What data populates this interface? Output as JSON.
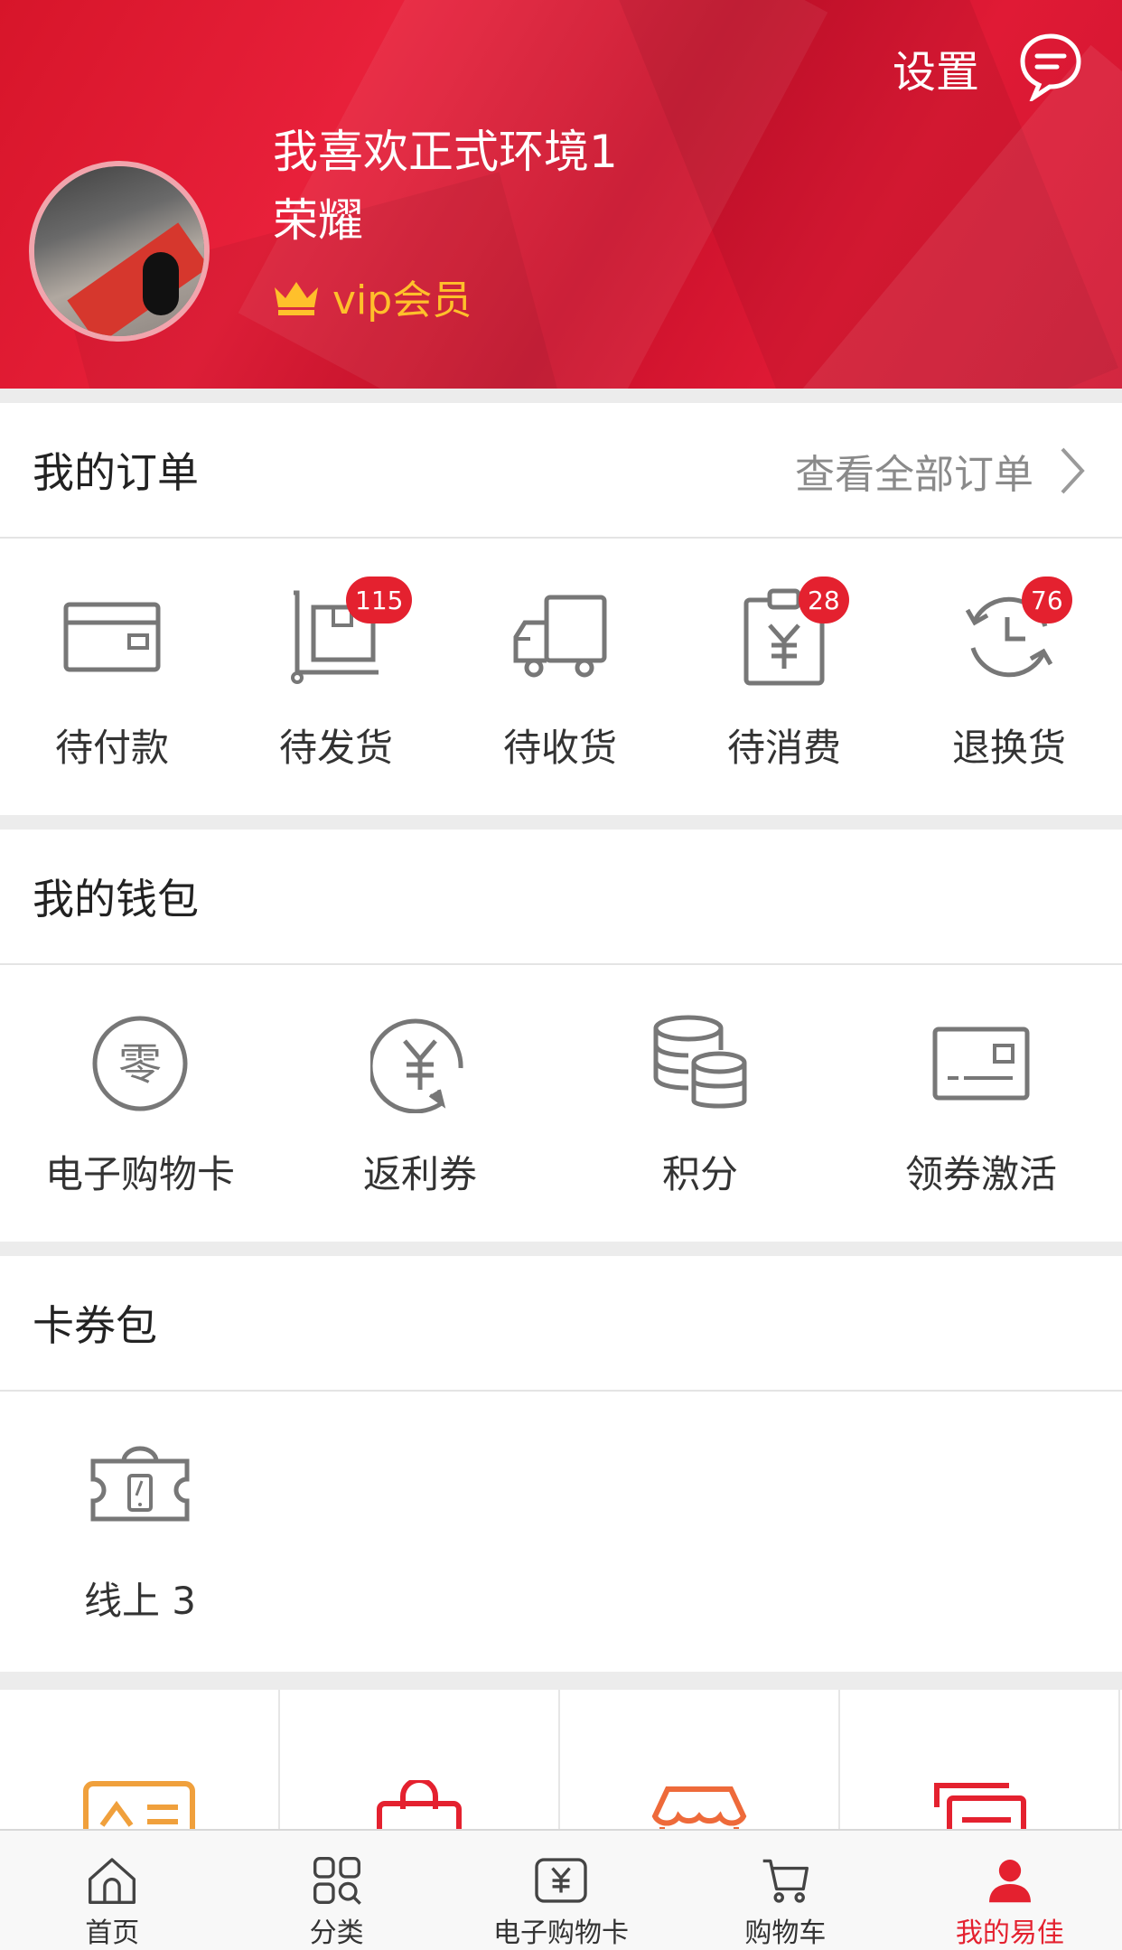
{
  "header": {
    "settings_label": "设置",
    "username": "我喜欢正式环境1荣耀",
    "vip_label": "vip会员"
  },
  "orders": {
    "title": "我的订单",
    "view_all": "查看全部订单",
    "items": [
      {
        "label": "待付款",
        "icon": "wallet-card-icon",
        "badge": ""
      },
      {
        "label": "待发货",
        "icon": "package-cart-icon",
        "badge": "115"
      },
      {
        "label": "待收货",
        "icon": "truck-icon",
        "badge": ""
      },
      {
        "label": "待消费",
        "icon": "clipboard-yen-icon",
        "badge": "28"
      },
      {
        "label": "退换货",
        "icon": "return-clock-icon",
        "badge": "76"
      }
    ]
  },
  "wallet": {
    "title": "我的钱包",
    "items": [
      {
        "label": "电子购物卡",
        "icon": "zero-coin-icon"
      },
      {
        "label": "返利券",
        "icon": "yen-rebate-icon"
      },
      {
        "label": "积分",
        "icon": "coins-stack-icon"
      },
      {
        "label": "领券激活",
        "icon": "card-activate-icon"
      }
    ]
  },
  "coupons": {
    "title": "卡券包",
    "items": [
      {
        "label": "线上 3",
        "icon": "phone-ticket-icon"
      }
    ]
  },
  "services": [
    {
      "icon": "id-card-icon",
      "color": "#f0a03c"
    },
    {
      "icon": "shopping-bag-icon",
      "color": "#e4212f"
    },
    {
      "icon": "store-awning-icon",
      "color": "#ee6a3a"
    },
    {
      "icon": "documents-icon",
      "color": "#e4212f"
    }
  ],
  "tabbar": [
    {
      "label": "首页",
      "icon": "home-icon"
    },
    {
      "label": "分类",
      "icon": "category-search-icon"
    },
    {
      "label": "电子购物卡",
      "icon": "yen-card-icon"
    },
    {
      "label": "购物车",
      "icon": "cart-icon"
    },
    {
      "label": "我的易佳",
      "icon": "user-icon"
    }
  ],
  "colors": {
    "brand_red": "#e4212f",
    "vip_gold": "#ffc02b"
  }
}
